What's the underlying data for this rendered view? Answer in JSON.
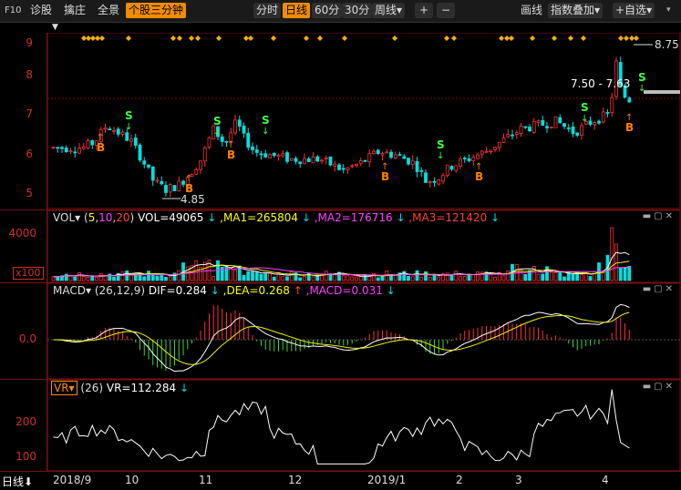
{
  "toolbar": {
    "f10": "F10",
    "diagnose": "诊股",
    "pick": "擒庄",
    "full": "全景",
    "stock3min": "个股三分钟",
    "tabs": [
      "分时",
      "日线",
      "60分",
      "30分",
      "周线"
    ],
    "zoom_in": "+",
    "zoom_out": "−",
    "draw": "画线",
    "overlay": "指数叠加",
    "add_watch": "+自选",
    "dropdown_arrow": "▾"
  },
  "kline": {
    "y_ticks": [
      "9",
      "8",
      "7",
      "6",
      "5"
    ],
    "high_label": "8.75",
    "low_label": "4.85",
    "range_label": "7.50 - 7.63"
  },
  "vol": {
    "name": "VOL",
    "params": "(5,10,20)",
    "vol": "VOL=49065",
    "ma1": ",MA1=265804",
    "ma2": ",MA2=176716",
    "ma3": ",MA3=121420",
    "y_tick": "4000",
    "unit": "x100"
  },
  "macd": {
    "name": "MACD",
    "params": "(26,12,9)",
    "dif": "DIF=0.284",
    "dea": ",DEA=0.268",
    "macd": ",MACD=0.031",
    "y_tick": "0.0"
  },
  "vr": {
    "name": "VR",
    "params": "(26)",
    "vr": "VR=112.284",
    "y_ticks": [
      "200",
      "100"
    ]
  },
  "xaxis": {
    "period": "日线",
    "labels": [
      "2018/9",
      "10",
      "11",
      "12",
      "2019/1",
      "2",
      "3",
      "4"
    ]
  },
  "colors": {
    "up": "#ff3030",
    "down": "#00e0e0",
    "ma1": "#ffffff",
    "ma2": "#f0f000",
    "ma3": "#ff40ff",
    "signal_buy": "#ff8000",
    "signal_sell": "#40ff40",
    "diamond": "#ffb000",
    "border": "#7a1010"
  },
  "signals": {
    "buy": "B",
    "sell": "S"
  }
}
